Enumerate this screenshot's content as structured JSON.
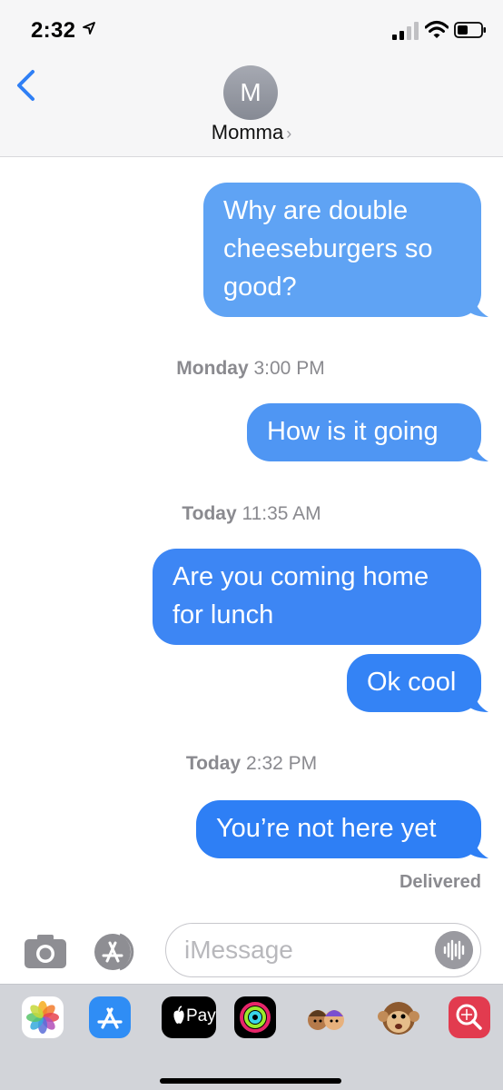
{
  "status_bar": {
    "time": "2:32"
  },
  "header": {
    "avatar_initial": "M",
    "contact_name": "Momma",
    "chevron": "›"
  },
  "messages": [
    {
      "text": "Why are double cheeseburgers so good?"
    },
    {
      "text": "How is it going"
    },
    {
      "text": "Are you coming home for lunch"
    },
    {
      "text": "Ok cool"
    },
    {
      "text": "You’re not here yet"
    }
  ],
  "timestamps": [
    {
      "day": "Monday",
      "time": "3:00 PM"
    },
    {
      "day": "Today",
      "time": "11:35 AM"
    },
    {
      "day": "Today",
      "time": "2:32 PM"
    }
  ],
  "delivered_label": "Delivered",
  "input": {
    "placeholder": "iMessage"
  },
  "drawer": {
    "apps": [
      "photos-icon",
      "app-store-icon",
      "apple-pay-icon",
      "activity-icon",
      "memoji-icon",
      "animoji-icon",
      "search-web-icon"
    ],
    "apple_pay_label": "Pay"
  },
  "colors": {
    "accent": "#2f7ff5",
    "bubble_top": "#5fa3f4",
    "timestamp": "#8a8a8f"
  }
}
